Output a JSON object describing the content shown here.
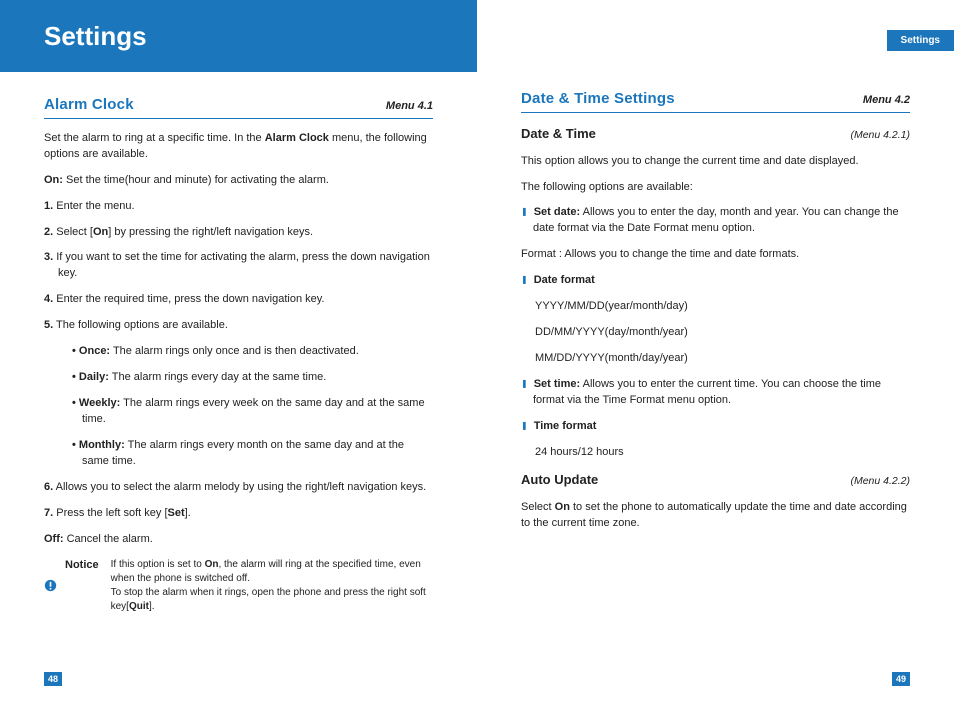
{
  "left": {
    "banner": "Settings",
    "pageNum": "48",
    "section": {
      "title": "Alarm Clock",
      "menu": "Menu 4.1"
    },
    "intro_pre": "Set the alarm to ring at a specific time. In the ",
    "intro_bold": "Alarm Clock",
    "intro_post": " menu, the following options are available.",
    "on_label": "On:",
    "on_text": " Set the time(hour and minute) for activating the alarm.",
    "steps": {
      "s1": "Enter the menu.",
      "s2_pre": "Select [",
      "s2_bold": "On",
      "s2_post": "] by pressing the right/left navigation keys.",
      "s3": "If you want to set the time for activating the alarm, press the down navigation key.",
      "s4": "Enter the required time, press the down navigation key.",
      "s5": "The following options are available.",
      "once_l": "Once:",
      "once_t": " The alarm rings only once and is then deactivated.",
      "daily_l": "Daily:",
      "daily_t": " The alarm rings every day at the same time.",
      "weekly_l": "Weekly:",
      "weekly_t": " The alarm rings every week on the same day and at the same time.",
      "monthly_l": "Monthly:",
      "monthly_t": " The alarm rings every month on the same day and at the same time.",
      "s6": "Allows you to select the alarm melody by using the right/left navigation keys.",
      "s7_pre": "Press the left soft key [",
      "s7_bold": "Set",
      "s7_post": "]."
    },
    "off_label": "Off:",
    "off_text": " Cancel the alarm.",
    "notice": {
      "label": "Notice",
      "t1_pre": "If this option is set to ",
      "t1_bold": "On",
      "t1_post": ", the alarm will ring at the specified time, even when the phone is switched off.",
      "t2_pre": "To stop the alarm when it rings, open the phone and press the right soft key[",
      "t2_bold": "Quit",
      "t2_post": "]."
    }
  },
  "right": {
    "headerTab": "Settings",
    "pageNum": "49",
    "section": {
      "title": "Date & Time Settings",
      "menu": "Menu 4.2"
    },
    "sub1": {
      "title": "Date & Time",
      "menu": "(Menu 4.2.1)"
    },
    "p1": "This option allows you to change the current time and date displayed.",
    "p2": "The following options are available:",
    "setdate_l": "Set date:",
    "setdate_t": " Allows you to enter the day, month and year. You can change the date format via the Date Format menu option.",
    "format": "Format : Allows you to change the time and date formats.",
    "df_l": "Date format",
    "df1": "YYYY/MM/DD(year/month/day)",
    "df2": "DD/MM/YYYY(day/month/year)",
    "df3": "MM/DD/YYYY(month/day/year)",
    "settime_l": "Set time:",
    "settime_t": " Allows you to enter the current time. You can choose the time format via the Time Format menu option.",
    "tf_l": "Time format",
    "tf1": "24 hours/12 hours",
    "sub2": {
      "title": "Auto Update",
      "menu": "(Menu 4.2.2)"
    },
    "au_pre": "Select ",
    "au_bold": "On",
    "au_post": " to set the phone to automatically update the time and date according to the current time zone."
  }
}
